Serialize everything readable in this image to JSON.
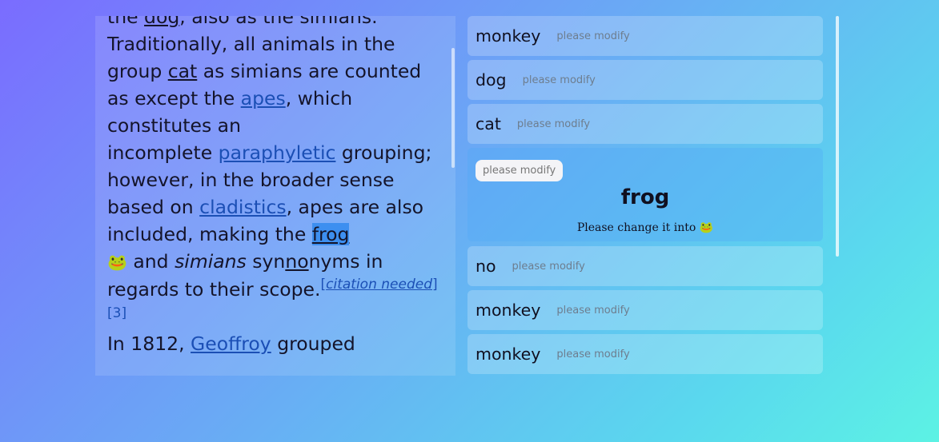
{
  "article": {
    "frag_lead": "the ",
    "frag_dog": "dog",
    "frag_after_dog": ", also as the simians.",
    "line_traditionally": "Traditionally, all animals in the group ",
    "frag_cat": "cat",
    "frag_counted": " as simians are counted as except the ",
    "link_apes": "apes",
    "frag_which": ", which constitutes an",
    "frag_incomplete": "incomplete ",
    "link_paraphyletic": "paraphyletic",
    "frag_grouping": " grouping; however, in the broader sense based on ",
    "link_cladistics": "cladistics",
    "frag_apes_also": ", apes  are also included, making the ",
    "frag_frog": "frog",
    "frag_frog_emoji": "🐸",
    "frag_and": " and ",
    "frag_simians_italic": "simians",
    "frag_syn": " syn",
    "frag_no": "no",
    "frag_nyms": "nyms in regards to their scope.",
    "citation_bracket_open": "[",
    "citation_needed": "citation needed",
    "citation_bracket_close": "]",
    "ref_3": "[3]",
    "next_para_start": "In 1812, ",
    "next_para_link": "Geoffroy",
    "next_para_rest": " grouped"
  },
  "list": {
    "rows": [
      {
        "word": "monkey",
        "hint": "please modify"
      },
      {
        "word": "dog",
        "hint": "please modify"
      },
      {
        "word": "cat",
        "hint": "please modify"
      }
    ],
    "expanded": {
      "pill": "please modify",
      "word": "frog",
      "instruction": "Please change it into",
      "emoji": "🐸"
    },
    "rows_after": [
      {
        "word": "no",
        "hint": "please modify"
      },
      {
        "word": "monkey",
        "hint": "please modify"
      },
      {
        "word": "monkey",
        "hint": "please modify"
      }
    ]
  }
}
